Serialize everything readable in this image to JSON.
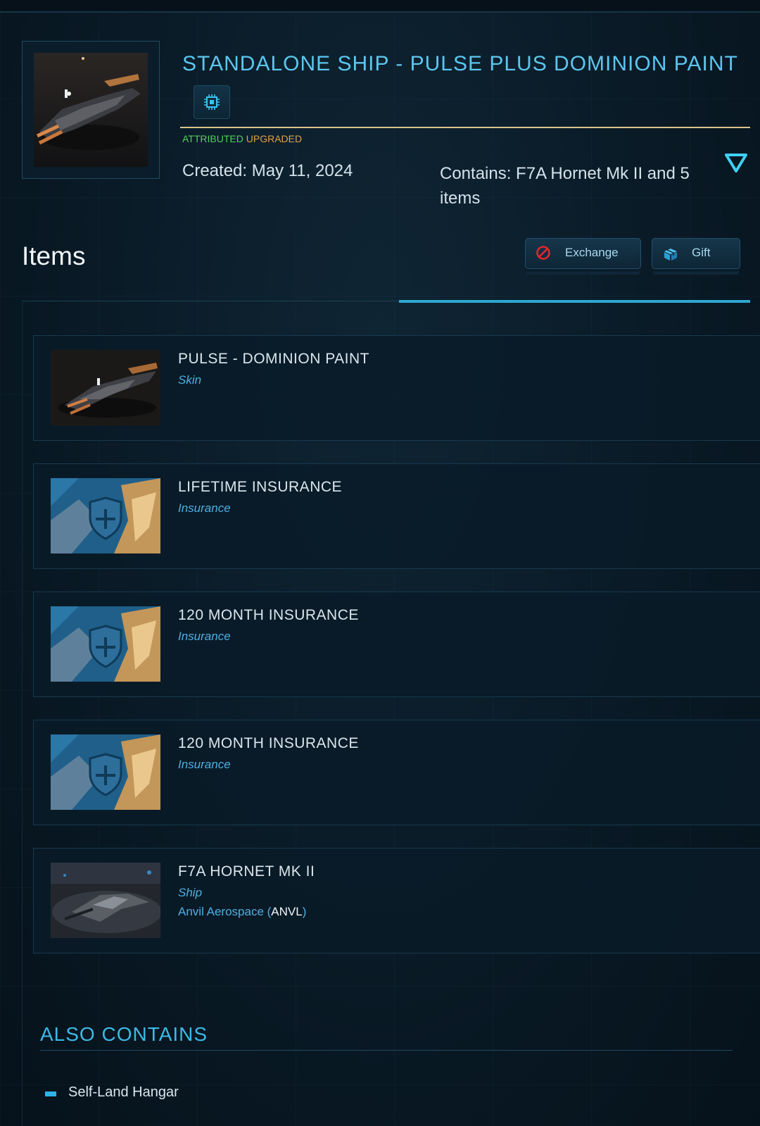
{
  "package": {
    "title": "STANDALONE SHIP - PULSE PLUS DOMINION PAINT",
    "tag_attributed": "ATTRIBUTED",
    "tag_upgraded": "UPGRADED",
    "created": "Created: May 11, 2024",
    "contains": "Contains: F7A Hornet Mk II and 5 items",
    "chip_icon": "chip-icon",
    "toggle_icon": "triangle-down-icon"
  },
  "items_section": {
    "heading": "Items",
    "exchange_label": "Exchange",
    "gift_label": "Gift"
  },
  "items": [
    {
      "name": "PULSE - DOMINION PAINT",
      "kind": "Skin",
      "thumb": "ship-render"
    },
    {
      "name": "LIFETIME INSURANCE",
      "kind": "Insurance",
      "thumb": "insurance-shield"
    },
    {
      "name": "120 MONTH INSURANCE",
      "kind": "Insurance",
      "thumb": "insurance-shield"
    },
    {
      "name": "120 MONTH INSURANCE",
      "kind": "Insurance",
      "thumb": "insurance-shield"
    },
    {
      "name": "F7A HORNET MK II",
      "kind": "Ship",
      "thumb": "hangar-ship",
      "maker_prefix": "Anvil Aerospace (",
      "maker_code": "ANVL",
      "maker_suffix": ")"
    }
  ],
  "also_contains": {
    "heading": "ALSO CONTAINS",
    "items": [
      "Self-Land Hangar"
    ]
  },
  "colors": {
    "accent": "#2fa7d1",
    "title": "#5cc6ef",
    "attributed": "#4fd05a",
    "upgraded": "#e0a24b",
    "divider_gold": "#d9c48a"
  }
}
